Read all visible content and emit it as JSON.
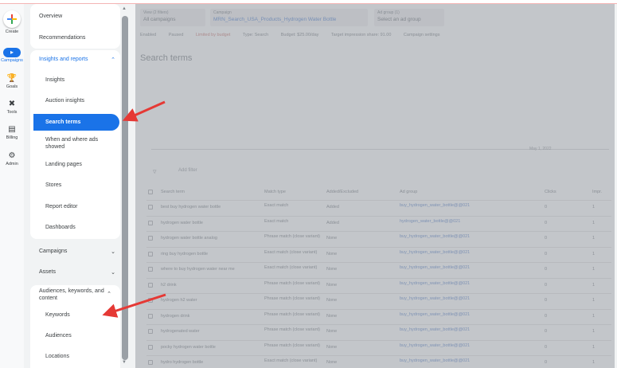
{
  "rail": {
    "items": [
      {
        "label": "Create",
        "icon": "plus-icon"
      },
      {
        "label": "Campaigns",
        "icon": "megaphone-icon"
      },
      {
        "label": "Goals",
        "icon": "trophy-icon"
      },
      {
        "label": "Tools",
        "icon": "tools-icon"
      },
      {
        "label": "Billing",
        "icon": "credit-card-icon"
      },
      {
        "label": "Admin",
        "icon": "gear-icon"
      }
    ]
  },
  "nav": {
    "overview": "Overview",
    "recommendations": "Recommendations",
    "insights_reports": "Insights and reports",
    "insights": "Insights",
    "auction_insights": "Auction insights",
    "search_terms": "Search terms",
    "when_where": "When and where ads showed",
    "landing_pages": "Landing pages",
    "stores": "Stores",
    "report_editor": "Report editor",
    "dashboards": "Dashboards",
    "campaigns": "Campaigns",
    "assets": "Assets",
    "audiences_keywords": "Audiences, keywords, and content",
    "keywords": "Keywords",
    "audiences": "Audiences",
    "locations": "Locations"
  },
  "main": {
    "selectors": [
      {
        "caption": "View (2 filters)",
        "value": "All campaigns"
      },
      {
        "caption": "Campaign",
        "value": "MRN_Search_USA_Products_Hydrogen Water Bottle"
      },
      {
        "caption": "Ad group (1)",
        "value": "Select an ad group"
      }
    ],
    "filterbar": [
      "Enabled",
      "Paused",
      "Limited by budget",
      "Type: Search",
      "Budget: $25.00/day",
      "Target impression share: 91.00",
      "Campaign settings"
    ],
    "title": "Search terms",
    "chart_date": "May 1, 2022",
    "add_filter": "Add filter",
    "columns": [
      "Search term",
      "Match type",
      "Added/Excluded",
      "Ad group",
      "Clicks",
      "Impr."
    ],
    "rows": [
      {
        "term": "best buy hydrogen water bottle",
        "match": "Exact match",
        "added": "Added",
        "group": "buy_hydrogen_water_bottle@@021",
        "clicks": "0",
        "impr": "1"
      },
      {
        "term": "hydrogen water bottle",
        "match": "Exact match",
        "added": "Added",
        "group": "hydrogen_water_bottle@@021",
        "clicks": "0",
        "impr": "1"
      },
      {
        "term": "hydrogen water bottle analog",
        "match": "Phrase match (close variant)",
        "added": "None",
        "group": "buy_hydrogen_water_bottle@@021",
        "clicks": "0",
        "impr": "1"
      },
      {
        "term": "ring buy hydrogen bottle",
        "match": "Exact match (close variant)",
        "added": "None",
        "group": "buy_hydrogen_water_bottle@@021",
        "clicks": "0",
        "impr": "1"
      },
      {
        "term": "where to buy hydrogen water near me",
        "match": "Exact match (close variant)",
        "added": "None",
        "group": "buy_hydrogen_water_bottle@@021",
        "clicks": "0",
        "impr": "1"
      },
      {
        "term": "h2 drink",
        "match": "Phrase match (close variant)",
        "added": "None",
        "group": "buy_hydrogen_water_bottle@@021",
        "clicks": "0",
        "impr": "1"
      },
      {
        "term": "hydrogen h2 water",
        "match": "Phrase match (close variant)",
        "added": "None",
        "group": "buy_hydrogen_water_bottle@@021",
        "clicks": "0",
        "impr": "1"
      },
      {
        "term": "hydrogen drink",
        "match": "Phrase match (close variant)",
        "added": "None",
        "group": "buy_hydrogen_water_bottle@@021",
        "clicks": "0",
        "impr": "1"
      },
      {
        "term": "hydrogenated water",
        "match": "Phrase match (close variant)",
        "added": "None",
        "group": "buy_hydrogen_water_bottle@@021",
        "clicks": "0",
        "impr": "1"
      },
      {
        "term": "pocky hydrogen water bottle",
        "match": "Phrase match (close variant)",
        "added": "None",
        "group": "buy_hydrogen_water_bottle@@021",
        "clicks": "0",
        "impr": "1"
      },
      {
        "term": "hydro hydrogen bottle",
        "match": "Exact match (close variant)",
        "added": "None",
        "group": "buy_hydrogen_water_bottle@@021",
        "clicks": "0",
        "impr": "1"
      }
    ]
  },
  "colors": {
    "accent": "#1a73e8",
    "arrow": "#e53935"
  }
}
